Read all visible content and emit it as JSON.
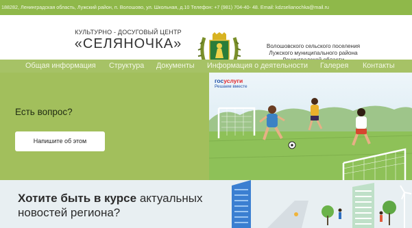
{
  "topbar": {
    "text": "188282, Ленинградская область, Лужский район, п. Волошово, ул. Школьная, д.10   Телефон: +7 (981) 704-40- 48. Email: kdzselianochka@mail.ru"
  },
  "header": {
    "org_subtitle": "КУЛЬТУРНО - ДОСУГОВЫЙ ЦЕНТР",
    "org_name": "«СЕЛЯНОЧКА»",
    "settlement_lines": [
      "Волошовского сельского поселения",
      "Лужского муниципального района",
      "Ленинградской области"
    ]
  },
  "nav": {
    "items": [
      {
        "label": "Общая информация"
      },
      {
        "label": "Структура"
      },
      {
        "label": "Документы"
      },
      {
        "label": "Информация о деятельности"
      },
      {
        "label": "Галерея"
      },
      {
        "label": "Контакты"
      }
    ]
  },
  "question_panel": {
    "title": "Есть вопрос?",
    "button_label": "Напишите об этом"
  },
  "banner": {
    "logo_part1": "гос",
    "logo_part2": "услуги",
    "tagline": "Решаем вместе"
  },
  "news": {
    "bold_text": "Хотите быть в курсе",
    "rest_text": " актуальных",
    "line2": "новостей региона?"
  },
  "colors": {
    "topbar": "#8fb84a",
    "nav": "#a6c266",
    "panel": "#a2bf5c",
    "gos_blue": "#1f4fa8",
    "gos_red": "#e0262c"
  },
  "icons": {
    "emblem": "coat-of-arms-icon"
  }
}
